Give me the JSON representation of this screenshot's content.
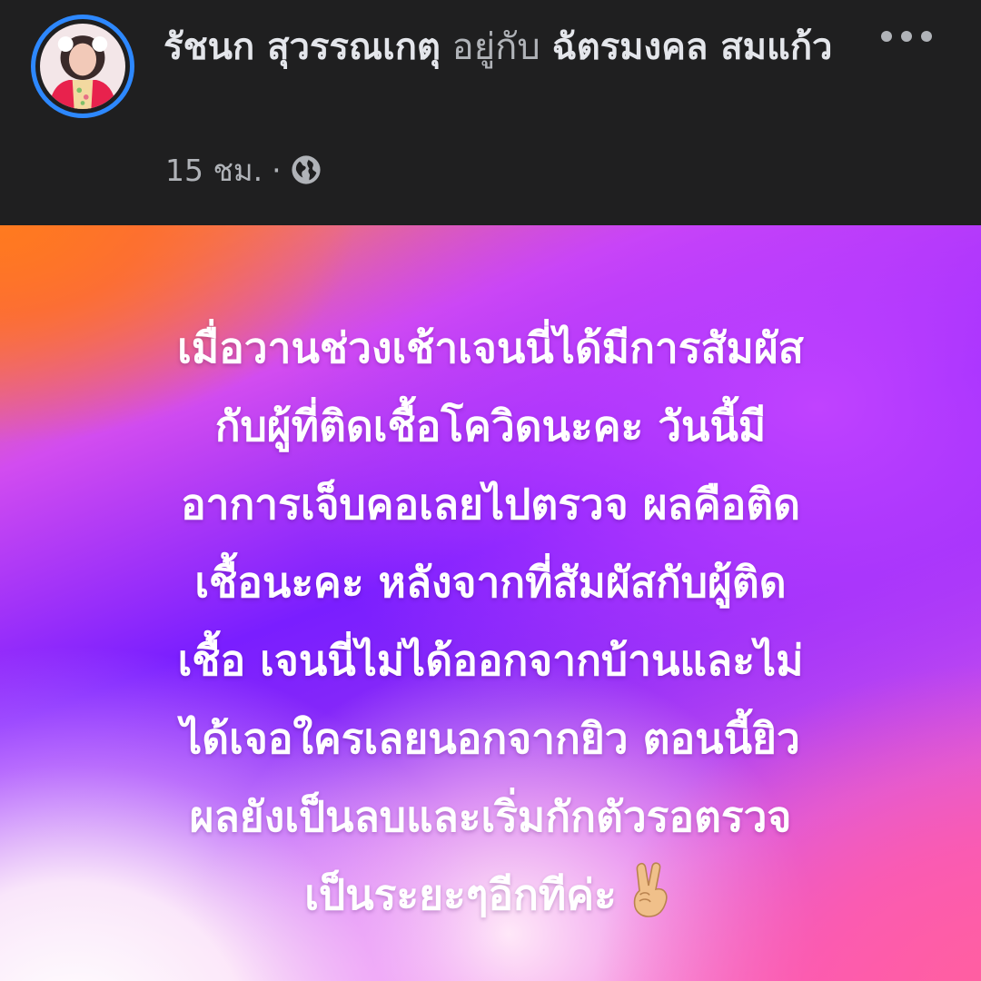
{
  "post": {
    "author_name": "รัชนก สุวรรณเกตุ",
    "with_word": "อยู่กับ",
    "tagged_name": "ฉัตรมงคล สมแก้ว",
    "timestamp": "15 ชม.",
    "separator": "·",
    "privacy_icon": "globe-icon",
    "more_icon": "more-dots-icon"
  },
  "status": {
    "lines": [
      "เมื่อวานช่วงเช้าเจนนี่ได้มีการสัมผัส",
      "กับผู้ที่ติดเชื้อโควิดนะคะ วันนี้มี",
      "อาการเจ็บคอเลยไปตรวจ ผลคือติด",
      "เชื้อนะคะ หลังจากที่สัมผัสกับผู้ติด",
      "เชื้อ เจนนี่ไม่ได้ออกจากบ้านและไม่",
      "ได้เจอใครเลยนอกจากยิว ตอนนี้ยิว",
      "ผลยังเป็นลบและเริ่มกักตัวรอตรวจ",
      "เป็นระยะๆอีกทีค่ะ"
    ],
    "emoji": "victory-hand-icon"
  },
  "colors": {
    "header_bg": "#1f1f20",
    "avatar_ring": "#2d88ff",
    "primary_text": "#e4e6eb",
    "secondary_text": "#b0b3b8",
    "status_text": "#ffffff"
  }
}
